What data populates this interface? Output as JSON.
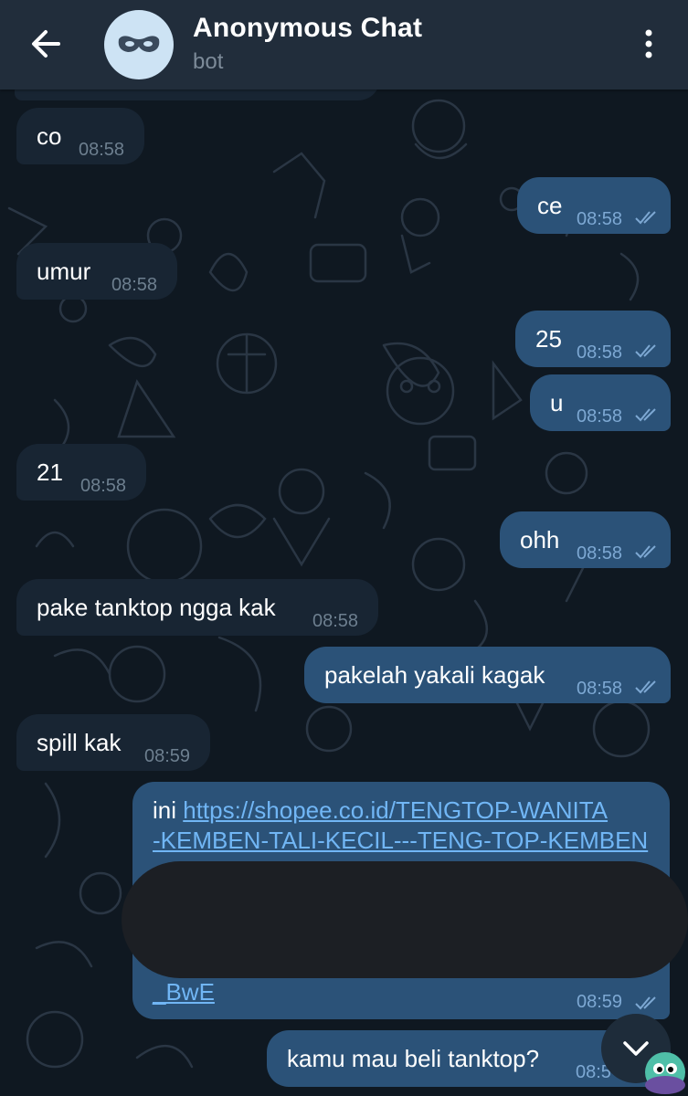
{
  "header": {
    "title": "Anonymous Chat",
    "subtitle": "bot",
    "back_icon": "arrow-left-icon",
    "menu_icon": "more-vertical-icon",
    "avatar_icon": "mask-icon"
  },
  "messages": [
    {
      "dir": "in",
      "text": "co",
      "time": "08:58"
    },
    {
      "dir": "out",
      "text": "ce",
      "time": "08:58",
      "read": true
    },
    {
      "dir": "in",
      "text": "umur",
      "time": "08:58"
    },
    {
      "dir": "out",
      "text": "25",
      "time": "08:58",
      "read": true
    },
    {
      "dir": "out",
      "text": "u",
      "time": "08:58",
      "read": true
    },
    {
      "dir": "in",
      "text": "21",
      "time": "08:58"
    },
    {
      "dir": "out",
      "text": "ohh",
      "time": "08:58",
      "read": true
    },
    {
      "dir": "in",
      "text": "pake tanktop ngga kak",
      "time": "08:58"
    },
    {
      "dir": "out",
      "text": "pakelah yakali kagak",
      "time": "08:58",
      "read": true
    },
    {
      "dir": "in",
      "text": "spill kak",
      "time": "08:59"
    }
  ],
  "link_message": {
    "prefix": "ini ",
    "line1": "https://shopee.co.id/TENGTOP-WANITA",
    "line2": "-KEMBEN-TALI-KECIL---TENG-TOP-KEMBEN",
    "line_last": "_BwE",
    "time": "08:59",
    "read": true
  },
  "last_message": {
    "dir": "out",
    "text": "kamu mau beli tanktop?",
    "time": "08:5"
  },
  "colors": {
    "header_bg": "#212d3b",
    "chat_bg": "#0f1821",
    "incoming_bubble": "#182533",
    "outgoing_bubble": "#2b5278",
    "link": "#71b6f5"
  },
  "scroll_icon": "chevron-down-icon"
}
